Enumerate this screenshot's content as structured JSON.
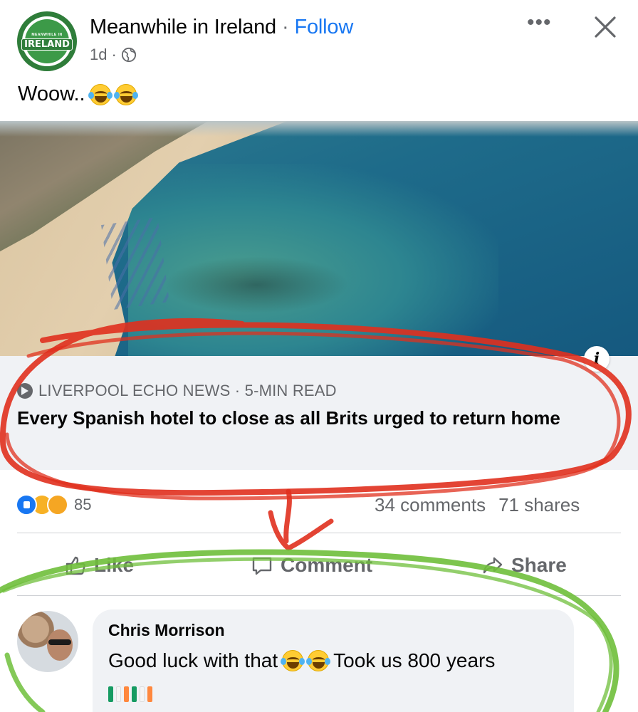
{
  "post": {
    "page_name": "Meanwhile in Ireland",
    "separator": "·",
    "follow_label": "Follow",
    "time": "1d",
    "time_separator": "·",
    "avatar_text_small": "MEANWHILE IN",
    "avatar_text": "IRELAND",
    "caption": "Woow..",
    "more_label": "•••"
  },
  "link_preview": {
    "source": "LIVERPOOL ECHO NEWS · 5-MIN READ",
    "headline": "Every Spanish hotel to close as all Brits urged to return home",
    "info_label": "i"
  },
  "stats": {
    "reactions_count": "85",
    "comments": "34 comments",
    "shares": "71 shares"
  },
  "actions": {
    "like": "Like",
    "comment": "Comment",
    "share": "Share"
  },
  "comment": {
    "author": "Chris Morrison",
    "text_before": "Good luck with that",
    "text_after": "Took us 800 years"
  },
  "colors": {
    "accent": "#1877f2",
    "secondary_text": "#65676b",
    "red_scribble": "#e0301e",
    "green_scribble": "#6fbf3b",
    "flag_green": "#169b62",
    "flag_white": "#ffffff",
    "flag_orange": "#ff883e"
  },
  "icons": [
    "page-logo",
    "globe-icon",
    "more-icon",
    "close-icon",
    "info-icon",
    "source-icon",
    "like-reaction-icon",
    "wow-reaction-icon",
    "care-reaction-icon",
    "like-icon",
    "comment-icon",
    "share-icon",
    "laughing-emoji",
    "irish-flag"
  ]
}
